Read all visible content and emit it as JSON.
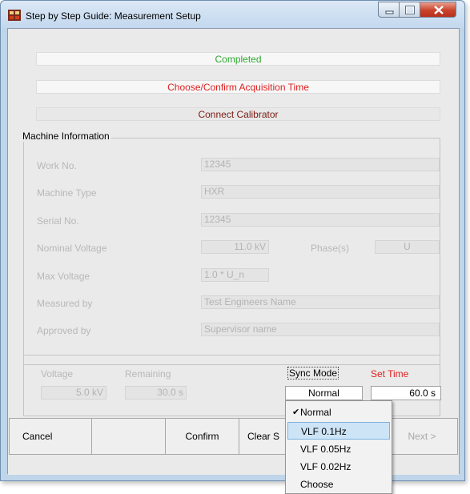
{
  "window": {
    "title": "Step by Step Guide: Measurement Setup"
  },
  "steps": {
    "completed": "Completed",
    "choose_acquisition": "Choose/Confirm Acquisition Time",
    "connect_calibrator": "Connect Calibrator"
  },
  "machine_info": {
    "legend": "Machine Information",
    "work_no_label": "Work No.",
    "work_no": "12345",
    "machine_type_label": "Machine Type",
    "machine_type": "HXR",
    "serial_no_label": "Serial No.",
    "serial_no": "12345",
    "nominal_voltage_label": "Nominal Voltage",
    "nominal_voltage": "11.0 kV",
    "phases_label": "Phase(s)",
    "phases": "U",
    "max_voltage_label": "Max Voltage",
    "max_voltage": "1.0 * U_n",
    "measured_by_label": "Measured by",
    "measured_by": "Test Engineers Name",
    "approved_by_label": "Approved by",
    "approved_by": "Supervisor name"
  },
  "acquisition": {
    "voltage_label": "Voltage",
    "voltage": "5.0 kV",
    "remaining_label": "Remaining",
    "remaining": "30.0 s",
    "sync_mode_label": "Sync Mode",
    "sync_mode": "Normal",
    "set_time_label": "Set Time",
    "set_time": "60.0 s"
  },
  "buttons": {
    "cancel": "Cancel",
    "confirm": "Confirm",
    "clear": "Clear S",
    "next": "Next >"
  },
  "sync_menu": {
    "items": [
      "Normal",
      "VLF 0.1Hz",
      "VLF 0.05Hz",
      "VLF 0.02Hz",
      "Choose"
    ],
    "checked": "Normal",
    "highlighted": "VLF 0.1Hz"
  },
  "colors": {
    "completed": "#2ea82e",
    "active_step": "#e02020",
    "pending_step": "#7a1c14",
    "set_time_label": "#e02020"
  }
}
